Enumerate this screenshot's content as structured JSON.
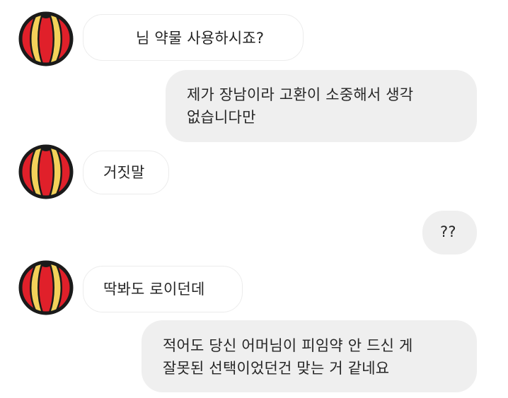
{
  "messages": [
    {
      "sender": "other",
      "text": "님 약물 사용하시죠?"
    },
    {
      "sender": "me",
      "lines": [
        "제가 장남이라 고환이 소중해서 생각",
        "없습니다만"
      ]
    },
    {
      "sender": "other",
      "text": "거짓말"
    },
    {
      "sender": "me",
      "text": "??"
    },
    {
      "sender": "other",
      "text": "딱봐도 로이던데"
    },
    {
      "sender": "me",
      "lines": [
        "적어도 당신 어머님이 피임약 안 드신 게",
        "잘못된 선택이었던건 맞는 거 같네요"
      ]
    }
  ],
  "colors": {
    "incoming_bg": "#ffffff",
    "incoming_border": "#ececec",
    "outgoing_bg": "#efefef",
    "text": "#262626",
    "avatar_red": "#e0202a",
    "avatar_yellow": "#f3d15a",
    "avatar_outline": "#1a1a1a"
  },
  "icons": {
    "avatar": "beach-ball-icon"
  }
}
